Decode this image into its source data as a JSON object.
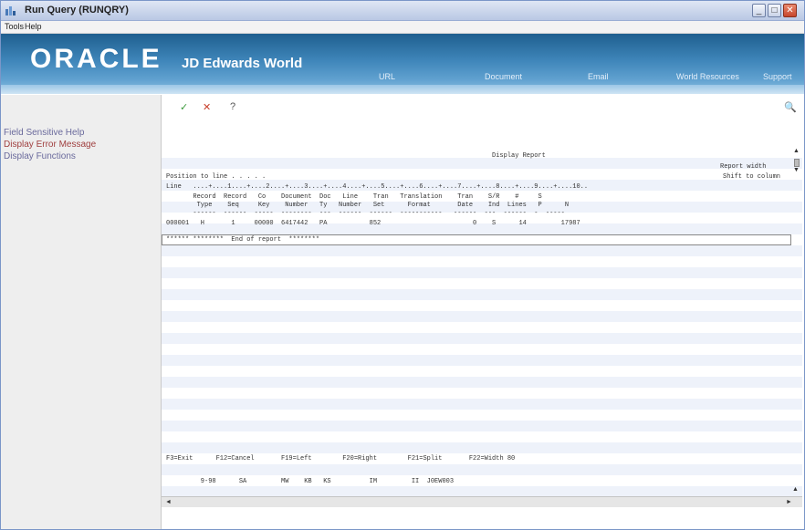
{
  "window": {
    "title": "Run Query (RUNQRY)"
  },
  "menu": [
    "Tools",
    "Help"
  ],
  "brand": {
    "logo": "ORACLE",
    "product": "JD Edwards World"
  },
  "banner_nav": [
    "URL",
    "Document",
    "Email",
    "World Resources",
    "Support"
  ],
  "sidebar": {
    "items": [
      {
        "label": "Field Sensitive Help"
      },
      {
        "label": "Display Error Message"
      },
      {
        "label": "Display Functions"
      }
    ]
  },
  "toolbar": {
    "ok": "✓",
    "cancel": "✕",
    "help": "?"
  },
  "report": {
    "title": "Display Report",
    "report_width": "Report width",
    "position_to_line": "Position to line . . . . .",
    "shift_to_column": "Shift to column",
    "ruler": "Line   ....+....1....+....2....+....3....+....4....+....5....+....6....+....7....+....8....+....9....+....10..",
    "header1": "       Record  Record   Co    Document  Doc   Line    Tran   Translation    Tran    S/R    #     S",
    "header2": "        Type    Seq     Key    Number   Ty   Number   Set      Format       Date    Ind  Lines   P      N",
    "underline": "       ------  ------  -----  --------  ---  ------  ------  -----------   ------  ---  ------  -  -----",
    "data_row": "000001   H       1     00000  6417442   PA           852                        0    S      14         17987",
    "end_row": "****** ********  End of report  ********",
    "function_keys": "F3=Exit      F12=Cancel       F19=Left        F20=Right        F21=Split       F22=Width 80",
    "status_line": "         9-98      SA         MW    KB   KS          IM         II  J0EW003"
  }
}
